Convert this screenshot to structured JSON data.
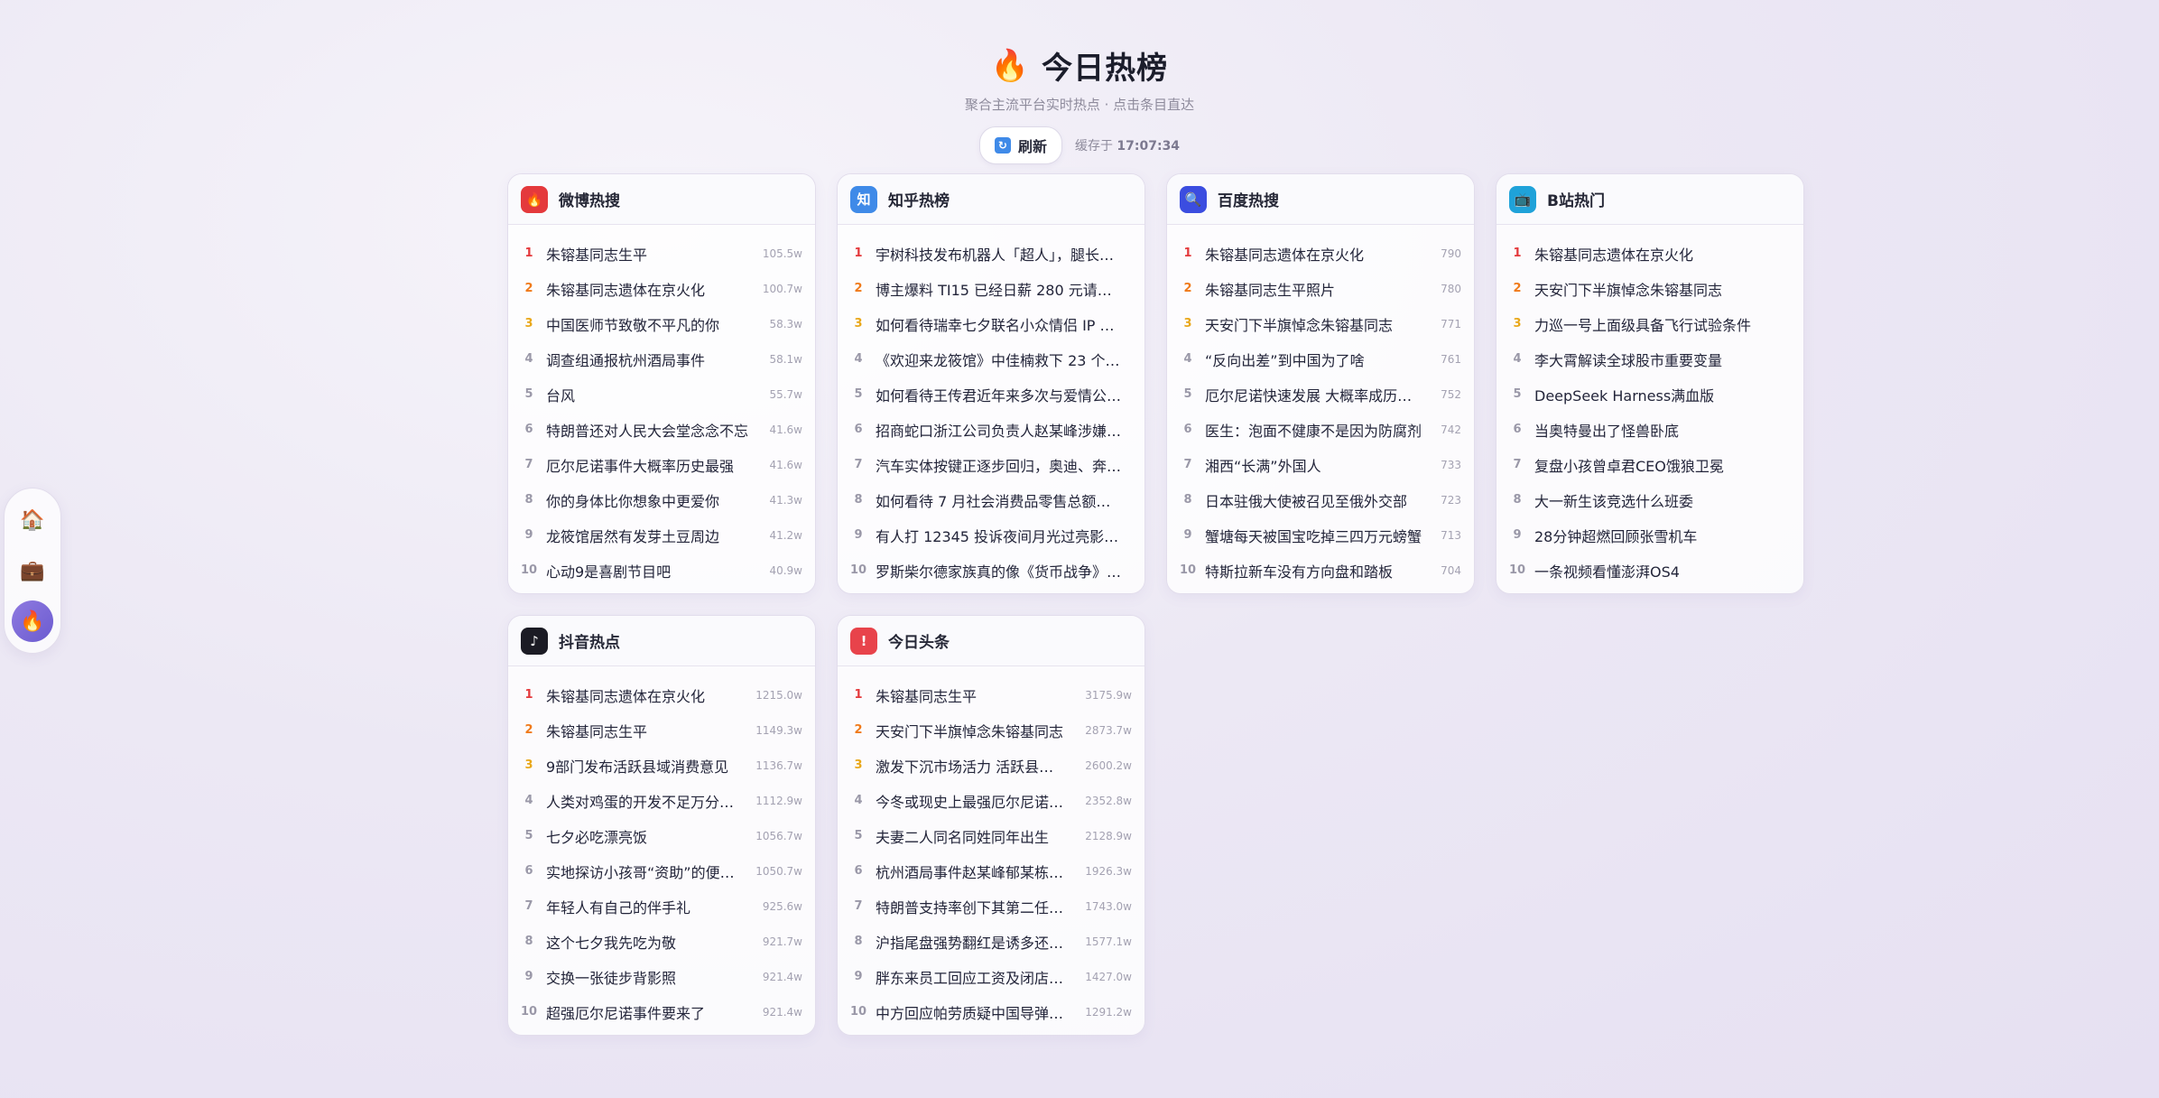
{
  "header": {
    "icon": "fire-icon",
    "title": "今日热榜",
    "subtitle": "聚合主流平台实时热点 · 点击条目直达",
    "refresh_label": "刷新",
    "cache_prefix": "缓存于",
    "cache_time": "17:07:34"
  },
  "dock": {
    "items": [
      {
        "icon": "home-icon",
        "active": false
      },
      {
        "icon": "briefcase-icon",
        "active": false
      },
      {
        "icon": "fire-icon",
        "active": true
      }
    ]
  },
  "boards": [
    {
      "title": "微博热搜",
      "icon": "weibo-icon",
      "color": "#e4393c",
      "glyph": "🔥",
      "items": [
        {
          "rank": "1",
          "text": "朱镕基同志生平",
          "heat": "105.5w"
        },
        {
          "rank": "2",
          "text": "朱镕基同志遗体在京火化",
          "heat": "100.7w"
        },
        {
          "rank": "3",
          "text": "中国医师节致敬不平凡的你",
          "heat": "58.3w"
        },
        {
          "rank": "4",
          "text": "调查组通报杭州酒局事件",
          "heat": "58.1w"
        },
        {
          "rank": "5",
          "text": "台风",
          "heat": "55.7w"
        },
        {
          "rank": "6",
          "text": "特朗普还对人民大会堂念念不忘",
          "heat": "41.6w"
        },
        {
          "rank": "7",
          "text": "厄尔尼诺事件大概率历史最强",
          "heat": "41.6w"
        },
        {
          "rank": "8",
          "text": "你的身体比你想象中更爱你",
          "heat": "41.3w"
        },
        {
          "rank": "9",
          "text": "龙筱馆居然有发芽土豆周边",
          "heat": "41.2w"
        },
        {
          "rank": "10",
          "text": "心动9是喜剧节目吧",
          "heat": "40.9w"
        }
      ]
    },
    {
      "title": "知乎热榜",
      "icon": "zhihu-icon",
      "color": "#3f8ae8",
      "glyph": "知",
      "items": [
        {
          "rank": "1",
          "text": "宇树科技发布机器人「超人」，腿长…",
          "heat": ""
        },
        {
          "rank": "2",
          "text": "博主爆料 TI15 已经日薪 280 元请人…",
          "heat": ""
        },
        {
          "rank": "3",
          "text": "如何看待瑞幸七夕联名小众情侣 IP …",
          "heat": ""
        },
        {
          "rank": "4",
          "text": "《欢迎来龙筱馆》中佳楠救下 23 个…",
          "heat": ""
        },
        {
          "rank": "5",
          "text": "如何看待王传君近年来多次与爱情公…",
          "heat": ""
        },
        {
          "rank": "6",
          "text": "招商蛇口浙江公司负责人赵某峰涉嫌…",
          "heat": ""
        },
        {
          "rank": "7",
          "text": "汽车实体按键正逐步回归，奥迪、奔…",
          "heat": ""
        },
        {
          "rank": "8",
          "text": "如何看待 7 月社会消费品零售总额…",
          "heat": ""
        },
        {
          "rank": "9",
          "text": "有人打 12345 投诉夜间月光过亮影…",
          "heat": ""
        },
        {
          "rank": "10",
          "text": "罗斯柴尔德家族真的像《货币战争》…",
          "heat": ""
        }
      ]
    },
    {
      "title": "百度热搜",
      "icon": "baidu-search-icon",
      "color": "#3b4de0",
      "glyph": "🔍",
      "items": [
        {
          "rank": "1",
          "text": "朱镕基同志遗体在京火化",
          "heat": "790"
        },
        {
          "rank": "2",
          "text": "朱镕基同志生平照片",
          "heat": "780"
        },
        {
          "rank": "3",
          "text": "天安门下半旗悼念朱镕基同志",
          "heat": "771"
        },
        {
          "rank": "4",
          "text": "“反向出差”到中国为了啥",
          "heat": "761"
        },
        {
          "rank": "5",
          "text": "厄尔尼诺快速发展 大概率成历…",
          "heat": "752"
        },
        {
          "rank": "6",
          "text": "医生：泡面不健康不是因为防腐剂",
          "heat": "742"
        },
        {
          "rank": "7",
          "text": "湘西“长满”外国人",
          "heat": "733"
        },
        {
          "rank": "8",
          "text": "日本驻俄大使被召见至俄外交部",
          "heat": "723"
        },
        {
          "rank": "9",
          "text": "蟹塘每天被国宝吃掉三四万元螃蟹",
          "heat": "713"
        },
        {
          "rank": "10",
          "text": "特斯拉新车没有方向盘和踏板",
          "heat": "704"
        }
      ]
    },
    {
      "title": "B站热门",
      "icon": "bilibili-icon",
      "color": "#1fa2d9",
      "glyph": "📺",
      "items": [
        {
          "rank": "1",
          "text": "朱镕基同志遗体在京火化",
          "heat": ""
        },
        {
          "rank": "2",
          "text": "天安门下半旗悼念朱镕基同志",
          "heat": ""
        },
        {
          "rank": "3",
          "text": "力巡一号上面级具备飞行试验条件",
          "heat": ""
        },
        {
          "rank": "4",
          "text": "李大霄解读全球股市重要变量",
          "heat": ""
        },
        {
          "rank": "5",
          "text": "DeepSeek Harness满血版",
          "heat": ""
        },
        {
          "rank": "6",
          "text": "当奥特曼出了怪兽卧底",
          "heat": ""
        },
        {
          "rank": "7",
          "text": "复盘小孩曾卓君CEO饿狼卫冕",
          "heat": ""
        },
        {
          "rank": "8",
          "text": "大一新生该竞选什么班委",
          "heat": ""
        },
        {
          "rank": "9",
          "text": "28分钟超燃回顾张雪机车",
          "heat": ""
        },
        {
          "rank": "10",
          "text": "一条视频看懂澎湃OS4",
          "heat": ""
        }
      ]
    },
    {
      "title": "抖音热点",
      "icon": "douyin-icon",
      "color": "#1b1b24",
      "glyph": "♪",
      "items": [
        {
          "rank": "1",
          "text": "朱镕基同志遗体在京火化",
          "heat": "1215.0w"
        },
        {
          "rank": "2",
          "text": "朱镕基同志生平",
          "heat": "1149.3w"
        },
        {
          "rank": "3",
          "text": "9部门发布活跃县域消费意见",
          "heat": "1136.7w"
        },
        {
          "rank": "4",
          "text": "人类对鸡蛋的开发不足万分…",
          "heat": "1112.9w"
        },
        {
          "rank": "5",
          "text": "七夕必吃漂亮饭",
          "heat": "1056.7w"
        },
        {
          "rank": "6",
          "text": "实地探访小孩哥“资助”的便…",
          "heat": "1050.7w"
        },
        {
          "rank": "7",
          "text": "年轻人有自己的伴手礼",
          "heat": "925.6w"
        },
        {
          "rank": "8",
          "text": "这个七夕我先吃为敬",
          "heat": "921.7w"
        },
        {
          "rank": "9",
          "text": "交换一张徒步背影照",
          "heat": "921.4w"
        },
        {
          "rank": "10",
          "text": "超强厄尔尼诺事件要来了",
          "heat": "921.4w"
        }
      ]
    },
    {
      "title": "今日头条",
      "icon": "toutiao-icon",
      "color": "#e8434b",
      "glyph": "!",
      "items": [
        {
          "rank": "1",
          "text": "朱镕基同志生平",
          "heat": "3175.9w"
        },
        {
          "rank": "2",
          "text": "天安门下半旗悼念朱镕基同志",
          "heat": "2873.7w"
        },
        {
          "rank": "3",
          "text": "激发下沉市场活力 活跃县…",
          "heat": "2600.2w"
        },
        {
          "rank": "4",
          "text": "今冬或现史上最强厄尔尼诺…",
          "heat": "2352.8w"
        },
        {
          "rank": "5",
          "text": "夫妻二人同名同姓同年出生",
          "heat": "2128.9w"
        },
        {
          "rank": "6",
          "text": "杭州酒局事件赵某峰郁某栋…",
          "heat": "1926.3w"
        },
        {
          "rank": "7",
          "text": "特朗普支持率创下其第二任…",
          "heat": "1743.0w"
        },
        {
          "rank": "8",
          "text": "沪指尾盘强势翻红是诱多还…",
          "heat": "1577.1w"
        },
        {
          "rank": "9",
          "text": "胖东来员工回应工资及闭店…",
          "heat": "1427.0w"
        },
        {
          "rank": "10",
          "text": "中方回应帕劳质疑中国导弹…",
          "heat": "1291.2w"
        }
      ]
    }
  ]
}
